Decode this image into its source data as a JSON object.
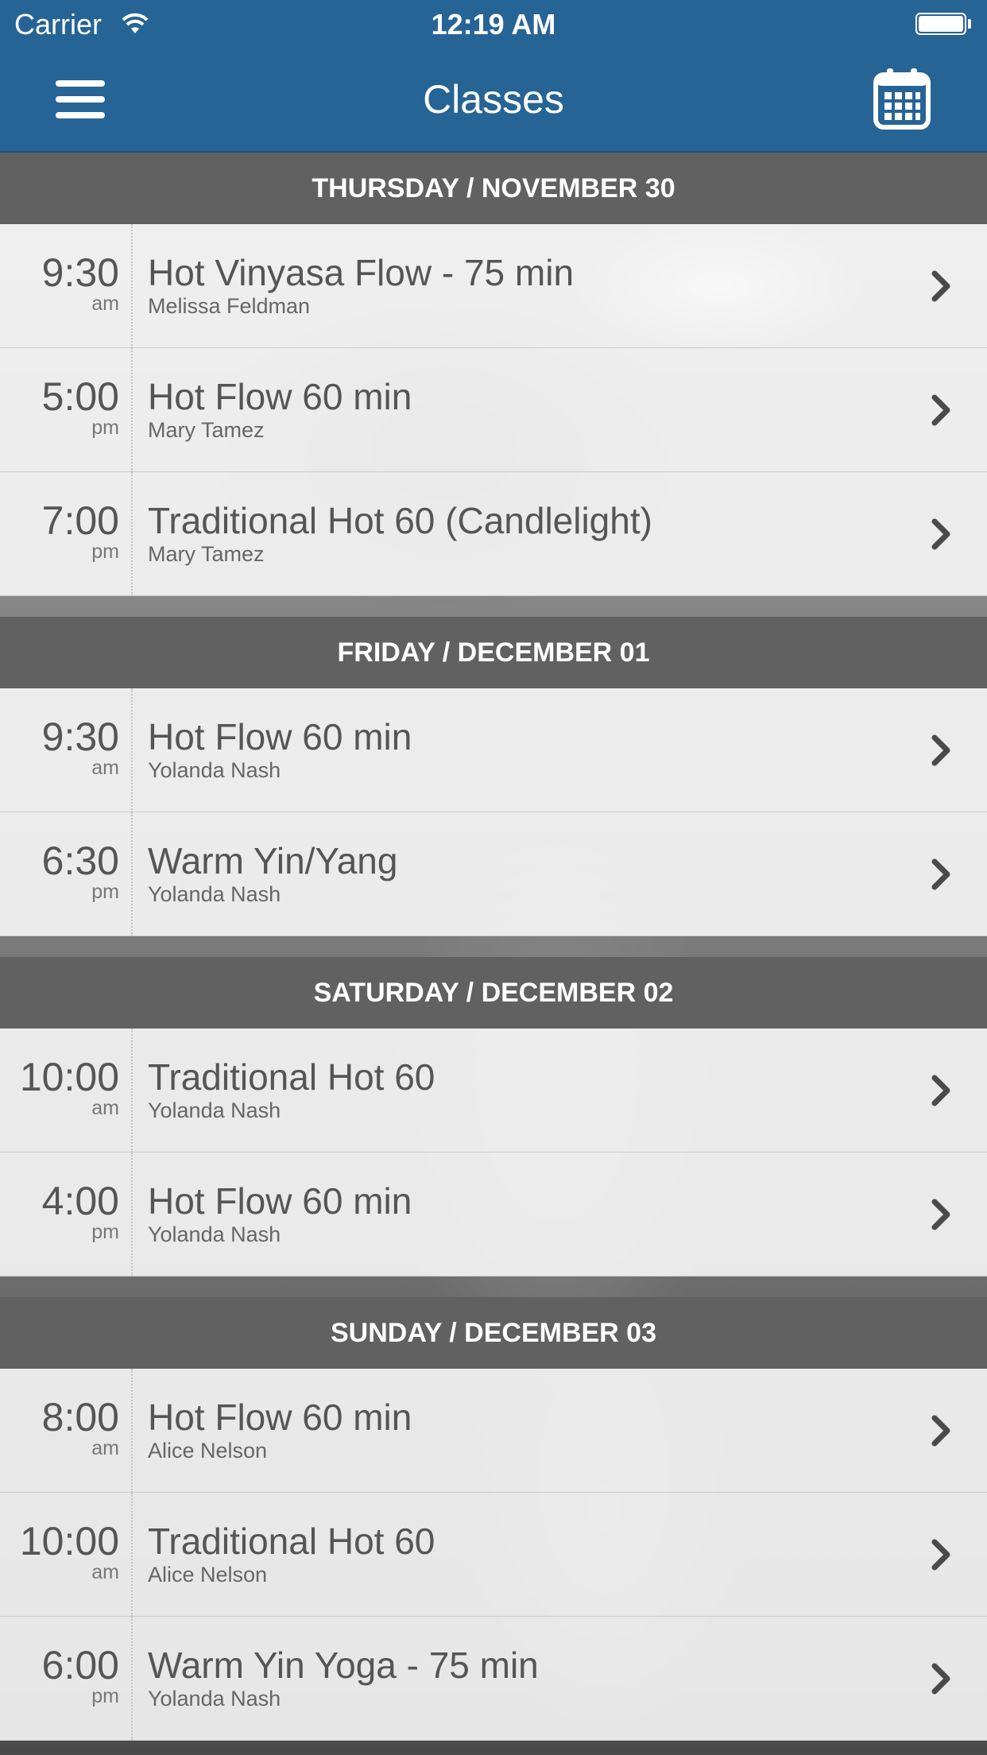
{
  "status_bar": {
    "carrier": "Carrier",
    "time": "12:19 AM"
  },
  "nav": {
    "title": "Classes"
  },
  "colors": {
    "brand": "#276496",
    "section_header": "#616161",
    "text": "#555555"
  },
  "icons": {
    "menu": "hamburger-menu-icon",
    "calendar": "calendar-icon",
    "row": "chevron-right-icon",
    "wifi": "wifi-icon",
    "battery": "battery-icon"
  },
  "schedule": [
    {
      "header": "THURSDAY / NOVEMBER 30",
      "classes": [
        {
          "time": "9:30",
          "ampm": "am",
          "name": "Hot Vinyasa Flow - 75 min",
          "teacher": "Melissa Feldman"
        },
        {
          "time": "5:00",
          "ampm": "pm",
          "name": "Hot Flow 60 min",
          "teacher": "Mary Tamez"
        },
        {
          "time": "7:00",
          "ampm": "pm",
          "name": "Traditional Hot 60 (Candlelight)",
          "teacher": "Mary Tamez"
        }
      ]
    },
    {
      "header": "FRIDAY / DECEMBER 01",
      "classes": [
        {
          "time": "9:30",
          "ampm": "am",
          "name": "Hot Flow 60 min",
          "teacher": "Yolanda Nash"
        },
        {
          "time": "6:30",
          "ampm": "pm",
          "name": "Warm Yin/Yang",
          "teacher": "Yolanda Nash"
        }
      ]
    },
    {
      "header": "SATURDAY / DECEMBER 02",
      "classes": [
        {
          "time": "10:00",
          "ampm": "am",
          "name": "Traditional Hot 60",
          "teacher": "Yolanda Nash"
        },
        {
          "time": "4:00",
          "ampm": "pm",
          "name": "Hot Flow 60 min",
          "teacher": "Yolanda Nash"
        }
      ]
    },
    {
      "header": "SUNDAY / DECEMBER 03",
      "classes": [
        {
          "time": "8:00",
          "ampm": "am",
          "name": "Hot Flow 60 min",
          "teacher": "Alice Nelson"
        },
        {
          "time": "10:00",
          "ampm": "am",
          "name": "Traditional Hot 60",
          "teacher": "Alice Nelson"
        },
        {
          "time": "6:00",
          "ampm": "pm",
          "name": "Warm Yin Yoga - 75 min",
          "teacher": "Yolanda Nash"
        }
      ]
    }
  ]
}
